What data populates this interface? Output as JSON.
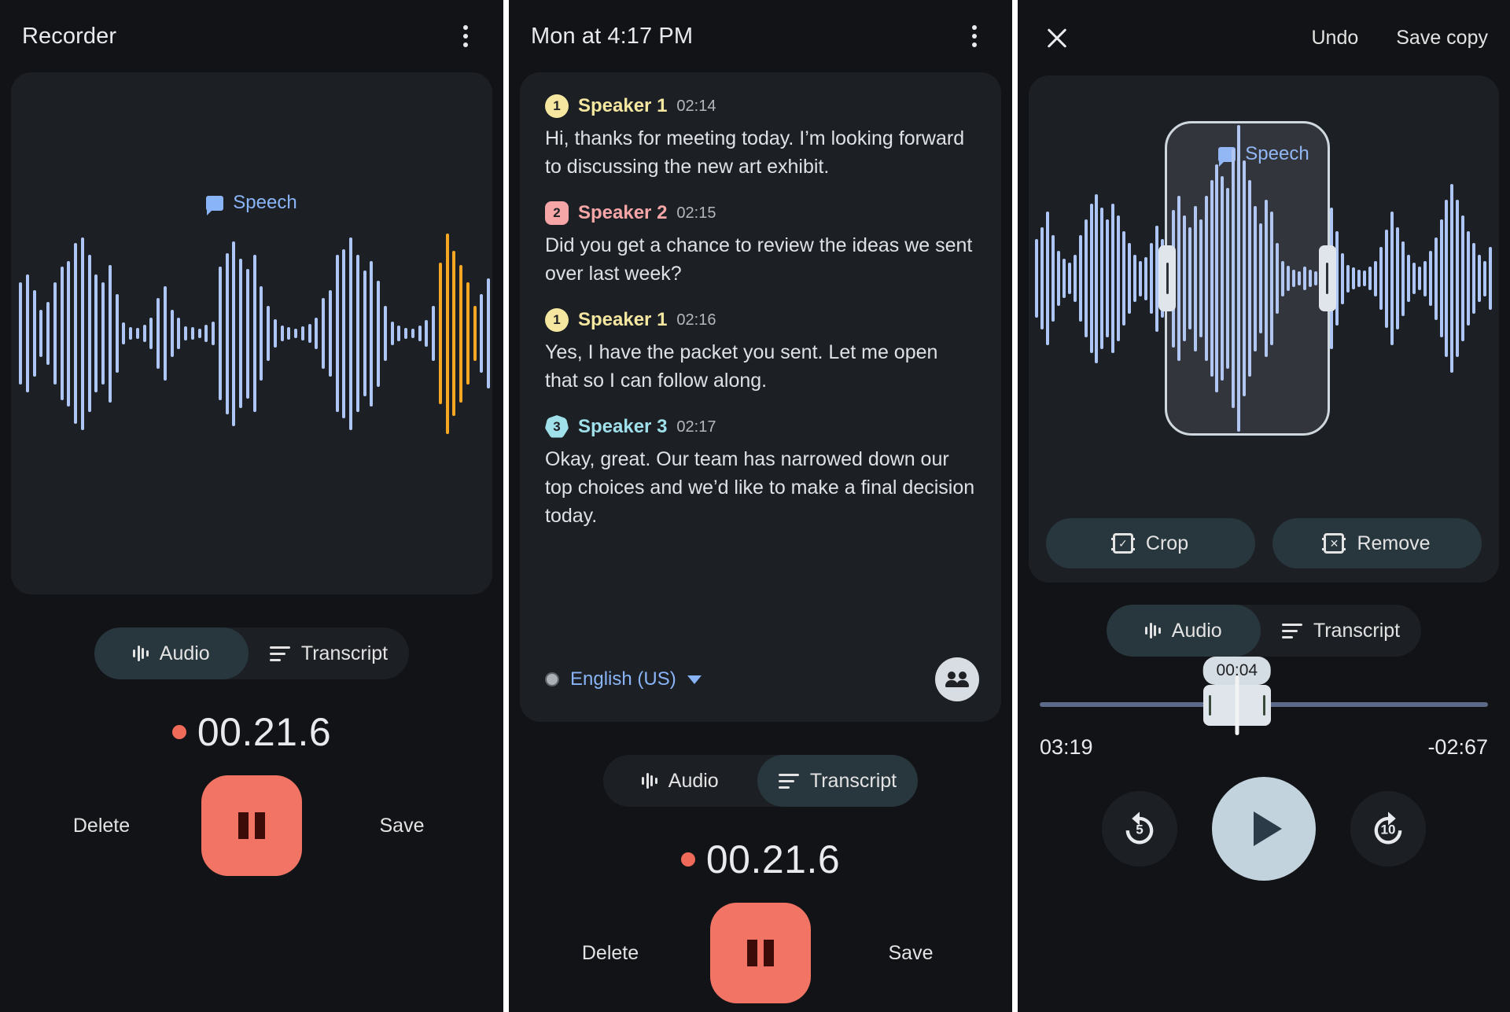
{
  "panel1": {
    "title": "Recorder",
    "menu_icon": "kebab-menu-icon",
    "chip": {
      "label": "Speech",
      "icon": "speech-bubble-icon",
      "color": "#8ab4f8"
    },
    "tabs": [
      {
        "label": "Audio",
        "icon": "waveform-icon",
        "active": true
      },
      {
        "label": "Transcript",
        "icon": "list-lines-icon",
        "active": false
      }
    ],
    "timer": "00.21.6",
    "recording_dot_color": "#f06a5a",
    "delete_label": "Delete",
    "save_label": "Save",
    "pause_button": "pause-icon",
    "waveform": {
      "bar_color": "#aec6f6",
      "highlight_color": "#f5a623",
      "heights": [
        130,
        150,
        110,
        60,
        80,
        130,
        170,
        185,
        230,
        245,
        200,
        150,
        130,
        175,
        100,
        28,
        16,
        14,
        22,
        40,
        90,
        120,
        60,
        40,
        18,
        16,
        12,
        22,
        30,
        170,
        205,
        235,
        190,
        165,
        200,
        120,
        70,
        36,
        20,
        16,
        12,
        18,
        24,
        40,
        90,
        110,
        200,
        215,
        245,
        200,
        160,
        185,
        135,
        70,
        30,
        20,
        14,
        12,
        20,
        34,
        70,
        180,
        255,
        210,
        175,
        130,
        70,
        100,
        140
      ],
      "highlight_start": 61,
      "highlight_end": 66
    }
  },
  "panel2": {
    "title": "Mon at 4:17 PM",
    "menu_icon": "kebab-menu-icon",
    "entries": [
      {
        "badge": "1",
        "speaker": "Speaker 1",
        "time": "02:14",
        "text": "Hi, thanks for meeting today. I’m looking forward to discussing the new art exhibit.",
        "color": "#f5e7a0",
        "shape": "circle"
      },
      {
        "badge": "2",
        "speaker": "Speaker 2",
        "time": "02:15",
        "text": "Did you get a chance to review the ideas we sent over last week?",
        "color": "#f6a6a6",
        "shape": "rounded-square"
      },
      {
        "badge": "1",
        "speaker": "Speaker 1",
        "time": "02:16",
        "text": "Yes, I have the packet you sent. Let me open that so I can follow along.",
        "color": "#f5e7a0",
        "shape": "circle"
      },
      {
        "badge": "3",
        "speaker": "Speaker 3",
        "time": "02:17",
        "text": "Okay, great. Our team has narrowed down our top choices and we’d like to make a final decision today.",
        "color": "#9fe0ea",
        "shape": "heptagon"
      }
    ],
    "language": {
      "label": "English (US)",
      "caret_icon": "chevron-down-icon",
      "dot_icon": "record-dot-icon"
    },
    "people_button_icon": "people-group-icon",
    "tabs": [
      {
        "label": "Audio",
        "icon": "waveform-icon",
        "active": false
      },
      {
        "label": "Transcript",
        "icon": "list-lines-icon",
        "active": true
      }
    ],
    "timer": "00.21.6",
    "delete_label": "Delete",
    "save_label": "Save",
    "pause_button": "pause-icon"
  },
  "panel3": {
    "close_icon": "close-x-icon",
    "undo_label": "Undo",
    "save_copy_label": "Save copy",
    "chip": {
      "label": "Speech",
      "icon": "speech-bubble-icon",
      "color": "#8ab4f8"
    },
    "edit_buttons": [
      {
        "label": "Crop",
        "icon": "crop-film-icon"
      },
      {
        "label": "Remove",
        "icon": "remove-film-icon"
      }
    ],
    "tabs": [
      {
        "label": "Audio",
        "icon": "waveform-icon",
        "active": true
      },
      {
        "label": "Transcript",
        "icon": "list-lines-icon",
        "active": false
      }
    ],
    "scrubber": {
      "tooltip": "00:04",
      "elapsed": "03:19",
      "remaining": "-02:67",
      "position_percent": 44
    },
    "controls": {
      "replay_label": "5",
      "replay_icon": "replay-5-icon",
      "play_icon": "play-icon",
      "forward_label": "10",
      "forward_icon": "forward-10-icon"
    },
    "waveform": {
      "bar_color": "#aec6f6",
      "heights": [
        100,
        130,
        170,
        110,
        70,
        50,
        40,
        60,
        110,
        150,
        190,
        215,
        180,
        150,
        190,
        160,
        120,
        90,
        60,
        45,
        55,
        90,
        135,
        100,
        75,
        175,
        210,
        160,
        130,
        185,
        150,
        210,
        250,
        290,
        260,
        230,
        330,
        390,
        300,
        250,
        185,
        140,
        200,
        170,
        90,
        45,
        32,
        22,
        18,
        30,
        22,
        18,
        22,
        30,
        180,
        120,
        65,
        35,
        28,
        22,
        20,
        30,
        45,
        80,
        125,
        170,
        130,
        95,
        60,
        40,
        30,
        45,
        70,
        105,
        150,
        200,
        240,
        200,
        160,
        120,
        90,
        60,
        45,
        80
      ]
    },
    "selection": {
      "start_percent": 29,
      "end_percent": 64
    }
  }
}
